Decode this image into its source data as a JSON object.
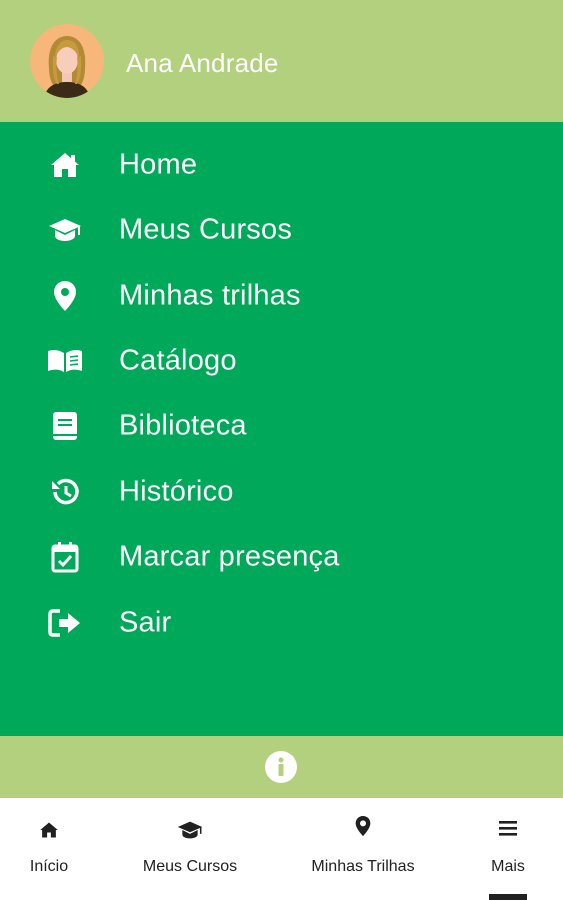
{
  "header": {
    "user_name": "Ana Andrade",
    "background_color": "#b3d07f"
  },
  "menu": {
    "background_color": "#00a859",
    "items": [
      {
        "label": "Home",
        "icon": "home-icon"
      },
      {
        "label": "Meus Cursos",
        "icon": "graduation-cap-icon"
      },
      {
        "label": "Minhas trilhas",
        "icon": "map-pin-icon"
      },
      {
        "label": "Catálogo",
        "icon": "open-book-icon"
      },
      {
        "label": "Biblioteca",
        "icon": "book-icon"
      },
      {
        "label": "Histórico",
        "icon": "history-icon"
      },
      {
        "label": "Marcar presença",
        "icon": "calendar-check-icon"
      },
      {
        "label": "Sair",
        "icon": "sign-out-icon"
      }
    ]
  },
  "info_bar": {
    "icon": "info-icon"
  },
  "bottom_nav": {
    "items": [
      {
        "label": "Início",
        "icon": "home-icon"
      },
      {
        "label": "Meus Cursos",
        "icon": "graduation-cap-icon"
      },
      {
        "label": "Minhas Trilhas",
        "icon": "map-pin-icon"
      },
      {
        "label": "Mais",
        "icon": "hamburger-menu-icon"
      }
    ],
    "active_index": 3
  }
}
